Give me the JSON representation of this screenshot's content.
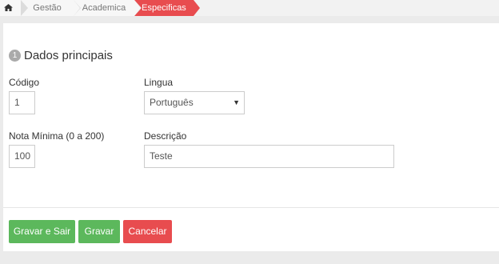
{
  "breadcrumb": {
    "home_icon": "home-icon",
    "items": [
      {
        "label": "Gestão",
        "active": false
      },
      {
        "label": "Academica",
        "active": false
      },
      {
        "label": "Especificas",
        "active": true
      }
    ]
  },
  "section": {
    "step": "1",
    "title": "Dados principais"
  },
  "form": {
    "codigo": {
      "label": "Código",
      "value": "1"
    },
    "lingua": {
      "label": "Lingua",
      "value": "Português"
    },
    "nota": {
      "label": "Nota Mínima (0 a 200)",
      "value": "100"
    },
    "descricao": {
      "label": "Descrição",
      "value": "Teste"
    }
  },
  "buttons": {
    "save_exit": "Gravar e Sair",
    "save": "Gravar",
    "cancel": "Cancelar"
  },
  "colors": {
    "active_crumb": "#e84c4f",
    "success": "#5cb85c",
    "danger": "#e84c4f"
  }
}
